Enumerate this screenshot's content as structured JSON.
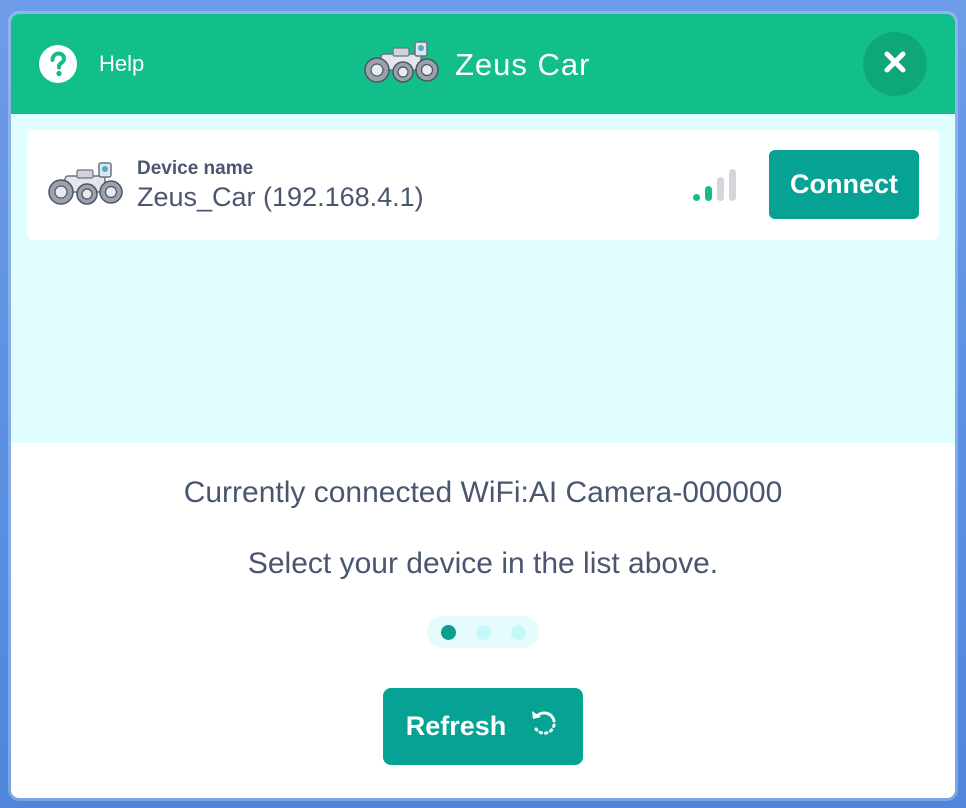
{
  "header": {
    "help_label": "Help",
    "title": "Zeus Car",
    "close_icon": "close-icon",
    "help_icon": "question-circle-icon"
  },
  "device_list": {
    "devices": [
      {
        "name_label": "Device name",
        "name_value": "Zeus_Car (192.168.4.1)",
        "signal_strength_bars": 2,
        "signal_total_bars": 4,
        "connect_label": "Connect"
      }
    ]
  },
  "footer": {
    "status_text": "Currently connected WiFi:AI Camera-000000",
    "hint_text": "Select your device in the list above.",
    "pager": {
      "total": 3,
      "active_index": 0
    },
    "refresh_label": "Refresh",
    "refresh_icon": "refresh-icon"
  },
  "colors": {
    "header_bg": "#12bf8a",
    "button_bg": "#06a395",
    "list_bg": "#e0fefe",
    "text": "#4a5670",
    "signal_active": "#12bf8a",
    "signal_inactive": "#d4d6dc"
  }
}
